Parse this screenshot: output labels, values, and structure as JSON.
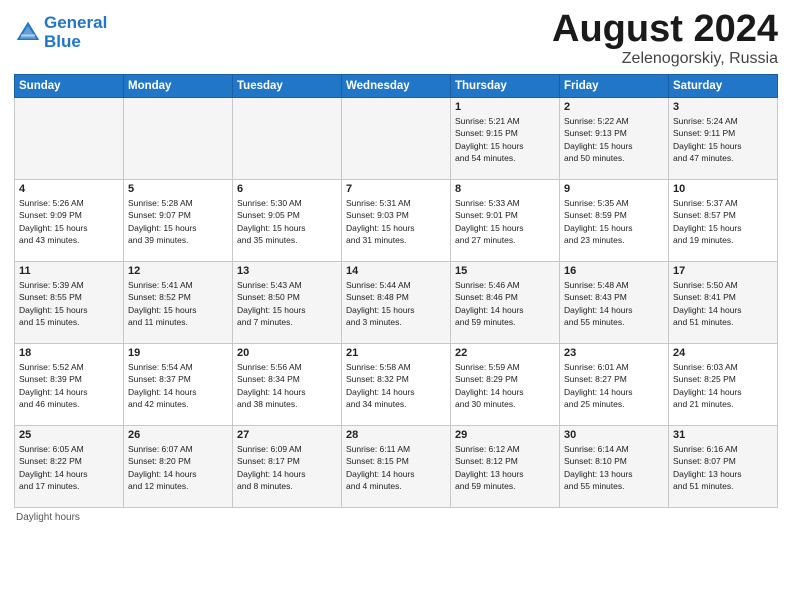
{
  "header": {
    "logo_line1": "General",
    "logo_line2": "Blue",
    "month": "August 2024",
    "location": "Zelenogorskiy, Russia"
  },
  "days_of_week": [
    "Sunday",
    "Monday",
    "Tuesday",
    "Wednesday",
    "Thursday",
    "Friday",
    "Saturday"
  ],
  "weeks": [
    [
      {
        "num": "",
        "info": ""
      },
      {
        "num": "",
        "info": ""
      },
      {
        "num": "",
        "info": ""
      },
      {
        "num": "",
        "info": ""
      },
      {
        "num": "1",
        "info": "Sunrise: 5:21 AM\nSunset: 9:15 PM\nDaylight: 15 hours\nand 54 minutes."
      },
      {
        "num": "2",
        "info": "Sunrise: 5:22 AM\nSunset: 9:13 PM\nDaylight: 15 hours\nand 50 minutes."
      },
      {
        "num": "3",
        "info": "Sunrise: 5:24 AM\nSunset: 9:11 PM\nDaylight: 15 hours\nand 47 minutes."
      }
    ],
    [
      {
        "num": "4",
        "info": "Sunrise: 5:26 AM\nSunset: 9:09 PM\nDaylight: 15 hours\nand 43 minutes."
      },
      {
        "num": "5",
        "info": "Sunrise: 5:28 AM\nSunset: 9:07 PM\nDaylight: 15 hours\nand 39 minutes."
      },
      {
        "num": "6",
        "info": "Sunrise: 5:30 AM\nSunset: 9:05 PM\nDaylight: 15 hours\nand 35 minutes."
      },
      {
        "num": "7",
        "info": "Sunrise: 5:31 AM\nSunset: 9:03 PM\nDaylight: 15 hours\nand 31 minutes."
      },
      {
        "num": "8",
        "info": "Sunrise: 5:33 AM\nSunset: 9:01 PM\nDaylight: 15 hours\nand 27 minutes."
      },
      {
        "num": "9",
        "info": "Sunrise: 5:35 AM\nSunset: 8:59 PM\nDaylight: 15 hours\nand 23 minutes."
      },
      {
        "num": "10",
        "info": "Sunrise: 5:37 AM\nSunset: 8:57 PM\nDaylight: 15 hours\nand 19 minutes."
      }
    ],
    [
      {
        "num": "11",
        "info": "Sunrise: 5:39 AM\nSunset: 8:55 PM\nDaylight: 15 hours\nand 15 minutes."
      },
      {
        "num": "12",
        "info": "Sunrise: 5:41 AM\nSunset: 8:52 PM\nDaylight: 15 hours\nand 11 minutes."
      },
      {
        "num": "13",
        "info": "Sunrise: 5:43 AM\nSunset: 8:50 PM\nDaylight: 15 hours\nand 7 minutes."
      },
      {
        "num": "14",
        "info": "Sunrise: 5:44 AM\nSunset: 8:48 PM\nDaylight: 15 hours\nand 3 minutes."
      },
      {
        "num": "15",
        "info": "Sunrise: 5:46 AM\nSunset: 8:46 PM\nDaylight: 14 hours\nand 59 minutes."
      },
      {
        "num": "16",
        "info": "Sunrise: 5:48 AM\nSunset: 8:43 PM\nDaylight: 14 hours\nand 55 minutes."
      },
      {
        "num": "17",
        "info": "Sunrise: 5:50 AM\nSunset: 8:41 PM\nDaylight: 14 hours\nand 51 minutes."
      }
    ],
    [
      {
        "num": "18",
        "info": "Sunrise: 5:52 AM\nSunset: 8:39 PM\nDaylight: 14 hours\nand 46 minutes."
      },
      {
        "num": "19",
        "info": "Sunrise: 5:54 AM\nSunset: 8:37 PM\nDaylight: 14 hours\nand 42 minutes."
      },
      {
        "num": "20",
        "info": "Sunrise: 5:56 AM\nSunset: 8:34 PM\nDaylight: 14 hours\nand 38 minutes."
      },
      {
        "num": "21",
        "info": "Sunrise: 5:58 AM\nSunset: 8:32 PM\nDaylight: 14 hours\nand 34 minutes."
      },
      {
        "num": "22",
        "info": "Sunrise: 5:59 AM\nSunset: 8:29 PM\nDaylight: 14 hours\nand 30 minutes."
      },
      {
        "num": "23",
        "info": "Sunrise: 6:01 AM\nSunset: 8:27 PM\nDaylight: 14 hours\nand 25 minutes."
      },
      {
        "num": "24",
        "info": "Sunrise: 6:03 AM\nSunset: 8:25 PM\nDaylight: 14 hours\nand 21 minutes."
      }
    ],
    [
      {
        "num": "25",
        "info": "Sunrise: 6:05 AM\nSunset: 8:22 PM\nDaylight: 14 hours\nand 17 minutes."
      },
      {
        "num": "26",
        "info": "Sunrise: 6:07 AM\nSunset: 8:20 PM\nDaylight: 14 hours\nand 12 minutes."
      },
      {
        "num": "27",
        "info": "Sunrise: 6:09 AM\nSunset: 8:17 PM\nDaylight: 14 hours\nand 8 minutes."
      },
      {
        "num": "28",
        "info": "Sunrise: 6:11 AM\nSunset: 8:15 PM\nDaylight: 14 hours\nand 4 minutes."
      },
      {
        "num": "29",
        "info": "Sunrise: 6:12 AM\nSunset: 8:12 PM\nDaylight: 13 hours\nand 59 minutes."
      },
      {
        "num": "30",
        "info": "Sunrise: 6:14 AM\nSunset: 8:10 PM\nDaylight: 13 hours\nand 55 minutes."
      },
      {
        "num": "31",
        "info": "Sunrise: 6:16 AM\nSunset: 8:07 PM\nDaylight: 13 hours\nand 51 minutes."
      }
    ]
  ],
  "footer": {
    "note": "Daylight hours"
  }
}
